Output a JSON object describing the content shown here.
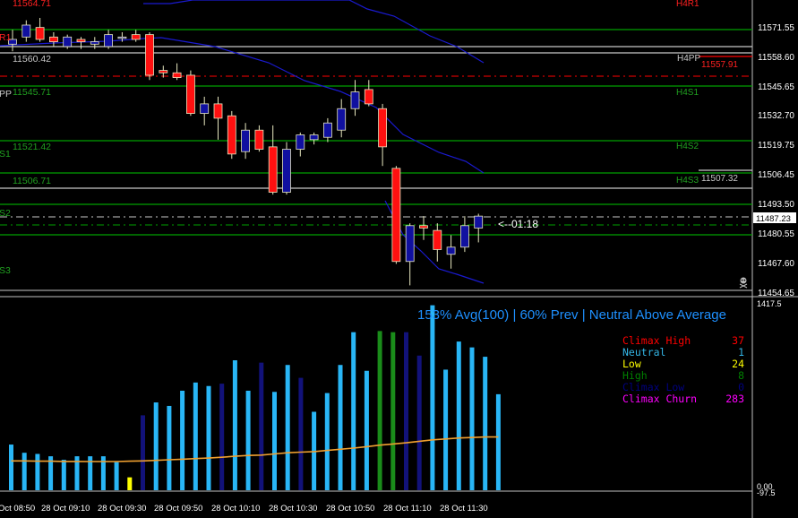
{
  "chart_data": [
    {
      "type": "candlestick",
      "pivot_labels": {
        "R1": "R1",
        "PP": "PP",
        "S1": "S1",
        "S2": "S2",
        "S3": "S3",
        "H4R1": "H4R1",
        "H4PP": "H4PP",
        "H4S1": "H4S1",
        "H4S2": "H4S2",
        "H4S3": "H4S3"
      },
      "level_values": {
        "top_red": "11564.71",
        "l1": "11560.42",
        "l2": "11545.71",
        "l3": "11521.42",
        "l4": "11506.71",
        "h4pp_value": "11557.91",
        "h4s3_value": "11507.32",
        "current_price": "11487.23"
      },
      "countdown": "<--01:18",
      "y_ticks": [
        "11571.55",
        "11558.60",
        "11545.65",
        "11532.70",
        "11519.75",
        "11506.45",
        "11493.50",
        "11480.55",
        "11467.60",
        "11454.65"
      ],
      "ylim": [
        11454.65,
        11578.5
      ],
      "candles": [
        {
          "o": 11560,
          "h": 11566,
          "l": 11557,
          "c": 11562
        },
        {
          "o": 11563,
          "h": 11570,
          "l": 11561,
          "c": 11568
        },
        {
          "o": 11567,
          "h": 11571,
          "l": 11561,
          "c": 11562
        },
        {
          "o": 11563,
          "h": 11565,
          "l": 11559,
          "c": 11561
        },
        {
          "o": 11559,
          "h": 11564,
          "l": 11558,
          "c": 11563
        },
        {
          "o": 11562,
          "h": 11563,
          "l": 11558,
          "c": 11561
        },
        {
          "o": 11560,
          "h": 11563,
          "l": 11558,
          "c": 11561
        },
        {
          "o": 11559,
          "h": 11566,
          "l": 11558,
          "c": 11564
        },
        {
          "o": 11563,
          "h": 11565,
          "l": 11561,
          "c": 11563
        },
        {
          "o": 11564,
          "h": 11566,
          "l": 11561,
          "c": 11562
        },
        {
          "o": 11564,
          "h": 11565,
          "l": 11545,
          "c": 11547
        },
        {
          "o": 11549,
          "h": 11551,
          "l": 11546,
          "c": 11548
        },
        {
          "o": 11548,
          "h": 11552,
          "l": 11545,
          "c": 11546
        },
        {
          "o": 11547,
          "h": 11549,
          "l": 11530,
          "c": 11531
        },
        {
          "o": 11531,
          "h": 11538,
          "l": 11526,
          "c": 11535
        },
        {
          "o": 11535,
          "h": 11538,
          "l": 11520,
          "c": 11529
        },
        {
          "o": 11530,
          "h": 11532,
          "l": 11512,
          "c": 11514
        },
        {
          "o": 11515,
          "h": 11527,
          "l": 11512,
          "c": 11524
        },
        {
          "o": 11524,
          "h": 11526,
          "l": 11515,
          "c": 11516
        },
        {
          "o": 11517,
          "h": 11526,
          "l": 11497,
          "c": 11498
        },
        {
          "o": 11498,
          "h": 11519,
          "l": 11497,
          "c": 11516
        },
        {
          "o": 11516,
          "h": 11523,
          "l": 11513,
          "c": 11522
        },
        {
          "o": 11520,
          "h": 11523,
          "l": 11518,
          "c": 11522
        },
        {
          "o": 11521,
          "h": 11529,
          "l": 11519,
          "c": 11527
        },
        {
          "o": 11524,
          "h": 11537,
          "l": 11521,
          "c": 11533
        },
        {
          "o": 11533,
          "h": 11545,
          "l": 11530,
          "c": 11540
        },
        {
          "o": 11541,
          "h": 11545,
          "l": 11534,
          "c": 11535
        },
        {
          "o": 11533,
          "h": 11535,
          "l": 11509,
          "c": 11517
        },
        {
          "o": 11508,
          "h": 11509,
          "l": 11468,
          "c": 11469
        },
        {
          "o": 11469,
          "h": 11485,
          "l": 11459,
          "c": 11484
        },
        {
          "o": 11484,
          "h": 11488,
          "l": 11478,
          "c": 11483
        },
        {
          "o": 11482,
          "h": 11485,
          "l": 11469,
          "c": 11474
        },
        {
          "o": 11472,
          "h": 11480,
          "l": 11466,
          "c": 11475
        },
        {
          "o": 11475,
          "h": 11488,
          "l": 11473,
          "c": 11484
        },
        {
          "o": 11483,
          "h": 11489,
          "l": 11477,
          "c": 11488
        }
      ]
    },
    {
      "type": "bar",
      "title": "153% Avg(100) | 60% Prev | Neutral Above Average",
      "y_ticks": [
        "1417.5",
        "0.00",
        "-97.5"
      ],
      "x_tick_labels": [
        "Oct 08:50",
        "28 Oct 09:10",
        "28 Oct 09:30",
        "28 Oct 09:50",
        "28 Oct 10:10",
        "28 Oct 10:30",
        "28 Oct 10:50",
        "28 Oct 11:10",
        "28 Oct 11:30"
      ],
      "legend": [
        {
          "label": "Climax High",
          "value": "37",
          "color": "#ff0000"
        },
        {
          "label": "Neutral",
          "value": "1",
          "color": "#33b5e5"
        },
        {
          "label": "Low",
          "value": "24",
          "color": "#ffff00"
        },
        {
          "label": "High",
          "value": "8",
          "color": "#008000"
        },
        {
          "label": "Climax Low",
          "value": "0",
          "color": "#000080"
        },
        {
          "label": "Climax Churn",
          "value": "283",
          "color": "#ff00ff"
        }
      ],
      "volumes": [
        390,
        320,
        310,
        290,
        260,
        290,
        290,
        290,
        240,
        110,
        640,
        750,
        720,
        850,
        920,
        890,
        910,
        1110,
        850,
        1090,
        840,
        1070,
        960,
        670,
        830,
        1070,
        1350,
        1020,
        1360,
        1350,
        1350,
        1150,
        1580,
        1030,
        1270,
        1220,
        1140,
        820
      ],
      "volume_types": [
        "n",
        "n",
        "n",
        "n",
        "n",
        "n",
        "n",
        "n",
        "n",
        "low",
        "cl",
        "n",
        "n",
        "n",
        "n",
        "n",
        "cl",
        "n",
        "n",
        "cl",
        "n",
        "n",
        "cl",
        "n",
        "n",
        "n",
        "n",
        "n",
        "hi",
        "hi",
        "cl",
        "cl",
        "n",
        "n",
        "n",
        "n",
        "n",
        "n"
      ],
      "average": [
        250,
        250,
        248,
        248,
        246,
        246,
        245,
        245,
        245,
        248,
        250,
        255,
        260,
        265,
        270,
        275,
        282,
        290,
        297,
        300,
        310,
        320,
        325,
        330,
        340,
        350,
        360,
        372,
        385,
        395,
        405,
        418,
        430,
        438,
        446,
        450,
        455,
        455
      ]
    }
  ]
}
